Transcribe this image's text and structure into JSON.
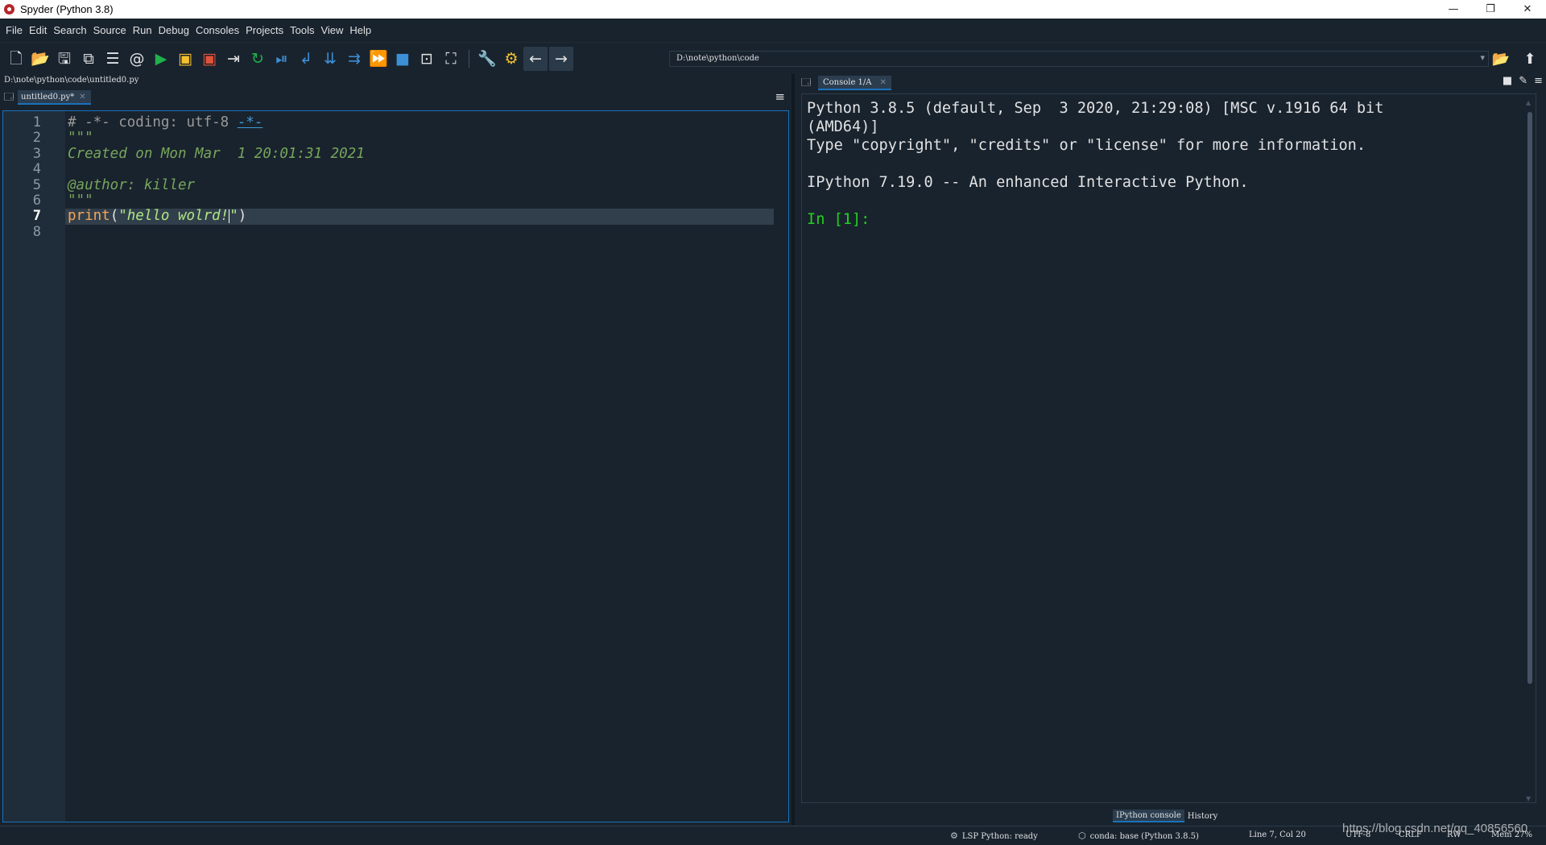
{
  "window": {
    "title": "Spyder (Python 3.8)",
    "controls": {
      "minimize": "—",
      "restore": "❐",
      "close": "✕"
    }
  },
  "menu": [
    "File",
    "Edit",
    "Search",
    "Source",
    "Run",
    "Debug",
    "Consoles",
    "Projects",
    "Tools",
    "View",
    "Help"
  ],
  "toolbar": {
    "working_directory": "D:\\note\\python\\code",
    "icons": [
      "new-file-icon",
      "open-file-icon",
      "save-icon",
      "save-all-icon",
      "outline-icon",
      "at-icon",
      "run-icon",
      "run-cell-icon",
      "run-cell-advance-icon",
      "run-selection-icon",
      "rerun-icon",
      "debug-icon",
      "step-icon",
      "step-into-icon",
      "step-return-icon",
      "continue-icon",
      "stop-icon",
      "maximize-pane-icon",
      "fullscreen-icon",
      "preferences-icon",
      "python-path-icon",
      "back-icon",
      "forward-icon",
      "browse-directory-icon",
      "parent-directory-icon"
    ]
  },
  "editor": {
    "file_path": "D:\\note\\python\\code\\untitled0.py",
    "tab_label": "untitled0.py*",
    "line_numbers": [
      "1",
      "2",
      "3",
      "4",
      "5",
      "6",
      "7",
      "8"
    ],
    "current_line": 7,
    "lines": {
      "l1_comment": "# -*- coding: utf-8 ",
      "l1_link": "-*-",
      "l2": "\"\"\"",
      "l3": "Created on Mon Mar  1 20:01:31 2021",
      "l4": "",
      "l5": "@author: killer",
      "l6": "\"\"\"",
      "l7_builtin": "print",
      "l7_open": "(",
      "l7_string_a": "\"hello wolrd!",
      "l7_string_b": "\"",
      "l7_close": ")",
      "l8": ""
    }
  },
  "console": {
    "tab_label": "Console 1/A",
    "lines": [
      "Python 3.8.5 (default, Sep  3 2020, 21:29:08) [MSC v.1916 64 bit",
      "(AMD64)]",
      "Type \"copyright\", \"credits\" or \"license\" for more information.",
      "",
      "IPython 7.19.0 -- An enhanced Interactive Python.",
      ""
    ],
    "prompt": "In [1]:",
    "bottom_tabs": [
      "IPython console",
      "History"
    ]
  },
  "status": {
    "lsp": "LSP Python: ready",
    "conda": "conda: base (Python 3.8.5)",
    "position": "Line 7, Col 20",
    "encoding": "UTF-8",
    "eol": "CRLF",
    "permissions": "RW",
    "memory": "Mem 27%"
  },
  "watermark": "https://blog.csdn.net/qq_40856560",
  "colors": {
    "background": "#19232d",
    "accent": "#1a72bb",
    "prompt": "#21d321",
    "docstring": "#77a55d",
    "builtin": "#f5a855",
    "string": "#b0e686"
  }
}
